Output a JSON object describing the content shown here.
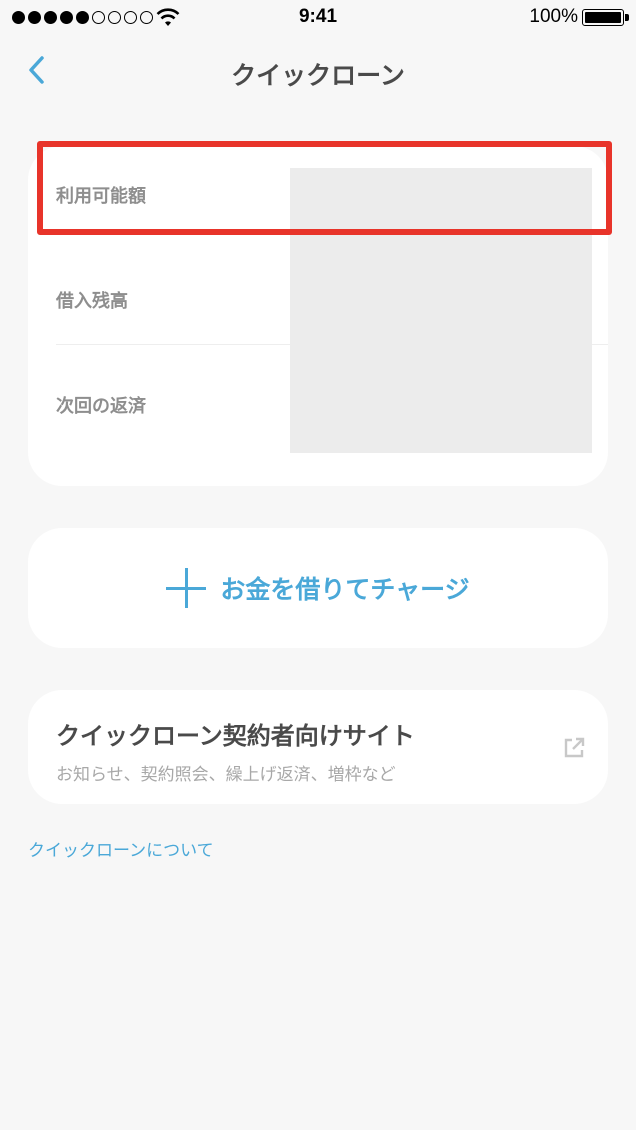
{
  "status_bar": {
    "time": "9:41",
    "battery_percent": "100%",
    "signal_bars_filled": 5,
    "signal_bars_total": 9
  },
  "nav": {
    "back_icon": "chevron-left-icon",
    "title": "クイックローン"
  },
  "summary": {
    "rows": [
      {
        "label": "利用可能額"
      },
      {
        "label": "借入残高"
      },
      {
        "label": "次回の返済"
      }
    ]
  },
  "charge": {
    "icon": "plus-icon",
    "label": "お金を借りてチャージ"
  },
  "site": {
    "title": "クイックローン契約者向けサイト",
    "subtitle": "お知らせ、契約照会、繰上げ返済、増枠など",
    "icon": "external-link-icon"
  },
  "about_link": "クイックローンについて",
  "colors": {
    "accent": "#4aa8d8",
    "highlight": "#e8342a",
    "background": "#f7f7f7",
    "card": "#ffffff"
  }
}
